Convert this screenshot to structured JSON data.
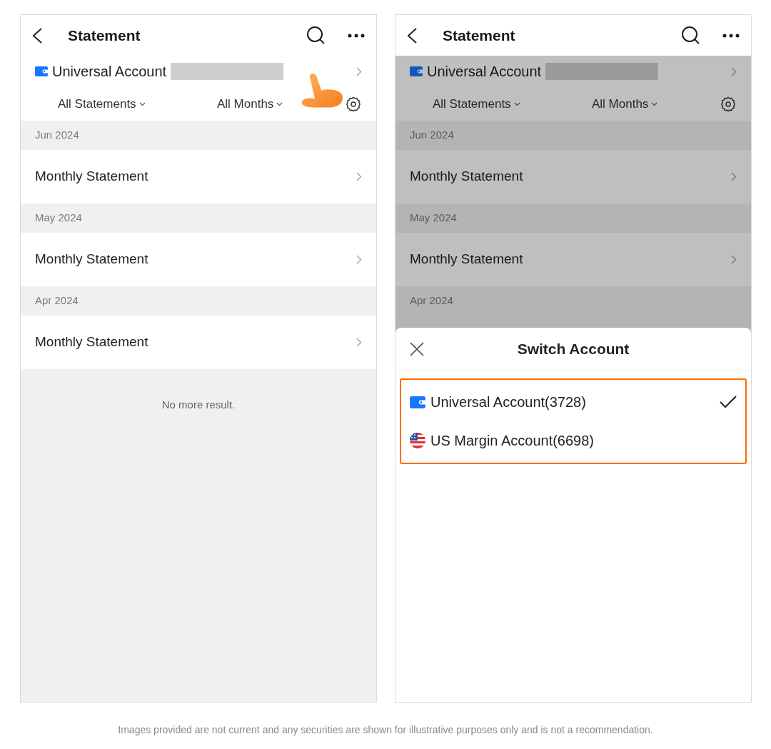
{
  "screens": [
    {
      "title": "Statement",
      "dimmed": false,
      "tap_hint": true,
      "account": {
        "name": "Universal Account"
      },
      "filters": [
        "All Statements",
        "All Months"
      ],
      "groups": [
        {
          "month": "Jun 2024",
          "items": [
            "Monthly Statement"
          ]
        },
        {
          "month": "May 2024",
          "items": [
            "Monthly Statement"
          ]
        },
        {
          "month": "Apr 2024",
          "items": [
            "Monthly Statement"
          ]
        }
      ],
      "end_text": "No more result."
    },
    {
      "title": "Statement",
      "dimmed": true,
      "tap_hint": false,
      "account": {
        "name": "Universal Account"
      },
      "filters": [
        "All Statements",
        "All Months"
      ],
      "groups": [
        {
          "month": "Jun 2024",
          "items": [
            "Monthly Statement"
          ]
        },
        {
          "month": "May 2024",
          "items": [
            "Monthly Statement"
          ]
        },
        {
          "month": "Apr 2024"
        }
      ],
      "sheet": {
        "title": "Switch Account",
        "highlighted": true,
        "accounts": [
          {
            "name": "Universal Account(3728)",
            "kind": "wallet",
            "selected": true
          },
          {
            "name": "US Margin Account(6698)",
            "kind": "flag",
            "selected": false
          }
        ]
      }
    }
  ],
  "footnote": "Images provided are not current and any securities are shown for illustrative purposes only and is not a recommendation."
}
